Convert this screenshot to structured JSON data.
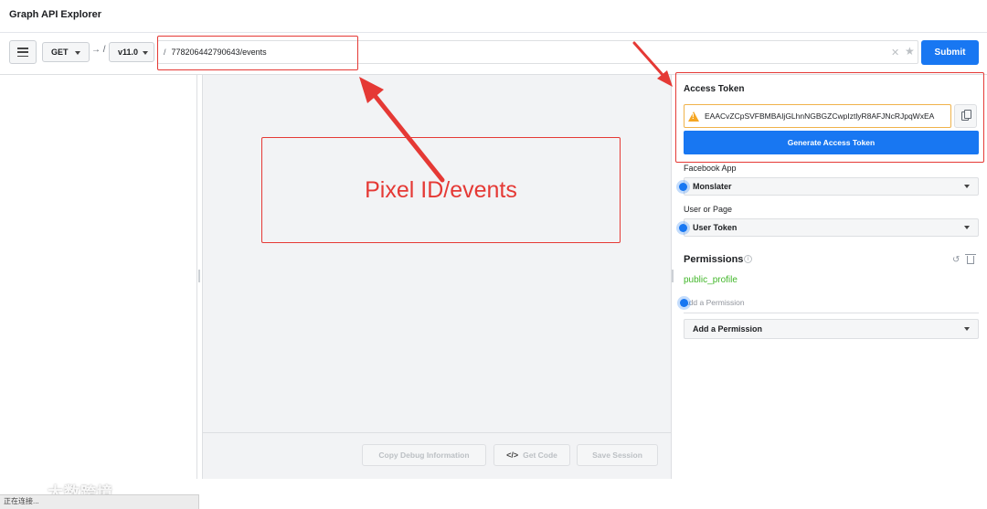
{
  "app": {
    "title": "Graph API Explorer"
  },
  "request": {
    "method": "GET",
    "separator": "→ /",
    "version": "v11.0",
    "path_prefix": "/",
    "path": "778206442790643/events",
    "submit_label": "Submit"
  },
  "center": {
    "annotation": "Pixel ID/events",
    "footer": {
      "copy_debug": "Copy Debug Information",
      "get_code": "Get Code",
      "save_session": "Save Session"
    }
  },
  "right": {
    "access_token_heading": "Access Token",
    "access_token_value": "EAACvZCpSVFBMBAIjGLhnNGBGZCwpIztlyR8AFJNcRJpqWxEA",
    "generate_label": "Generate Access Token",
    "facebook_app_label": "Facebook App",
    "facebook_app_value": "Monslater",
    "user_or_page_label": "User or Page",
    "user_or_page_value": "User Token",
    "permissions_heading": "Permissions",
    "permissions": [
      "public_profile"
    ],
    "add_permission_placeholder": "Add a Permission",
    "add_permission_select": "Add a Permission"
  },
  "status_bar": {
    "text": "正在连接..."
  },
  "watermark": {
    "text": "大数跨境"
  },
  "colors": {
    "accent": "#1877f2",
    "annotation": "#e53935",
    "permission": "#42b72a",
    "warning": "#f5a623"
  },
  "icons": [
    "menu-icon",
    "caret-down-icon",
    "clear-icon",
    "star-icon",
    "warning-icon",
    "copy-icon",
    "info-icon",
    "undo-icon",
    "trash-icon",
    "code-icon"
  ]
}
